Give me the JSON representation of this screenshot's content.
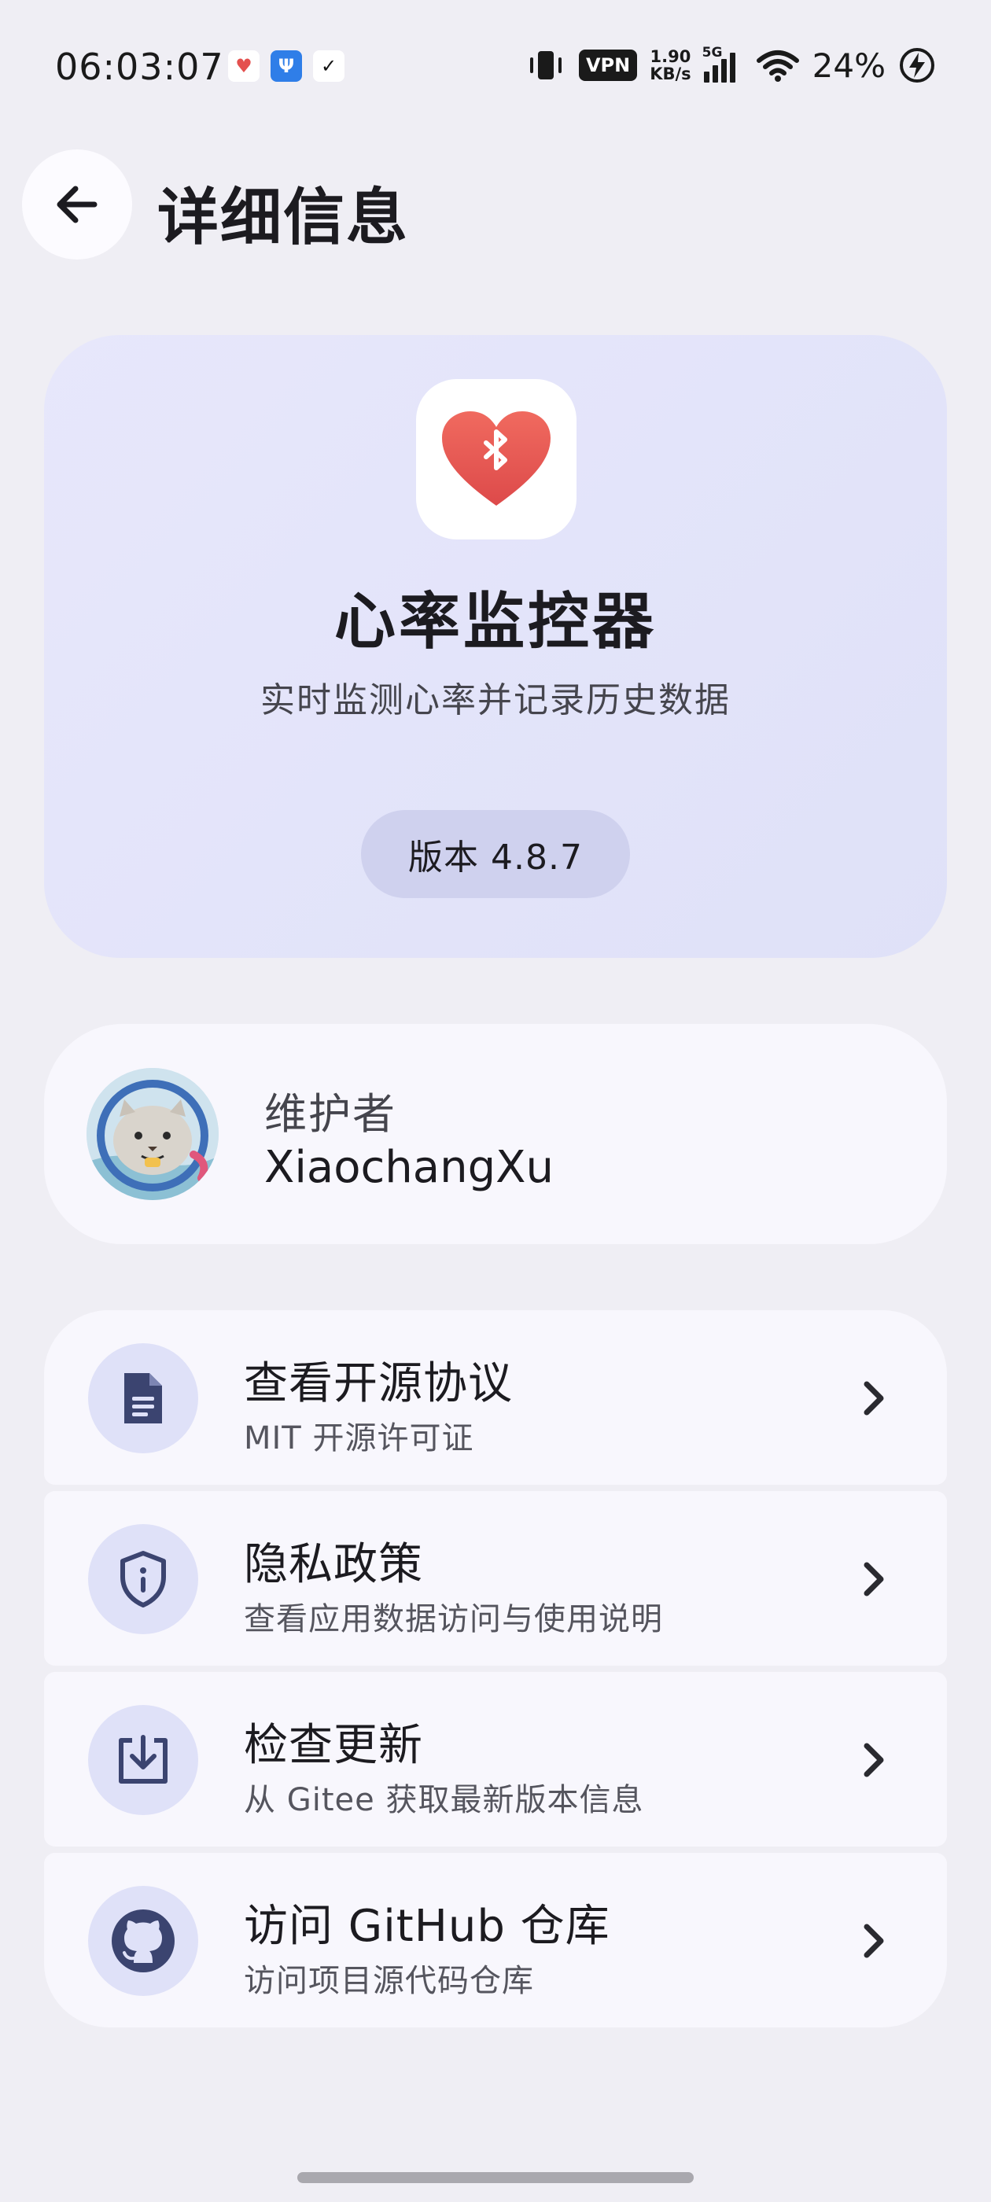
{
  "status_bar": {
    "time": "06:03:07",
    "vpn": "VPN",
    "net_speed_value": "1.90",
    "net_speed_unit": "KB/s",
    "network_type": "5G",
    "battery": "24%"
  },
  "header": {
    "title": "详细信息"
  },
  "app": {
    "name": "心率监控器",
    "description": "实时监测心率并记录历史数据",
    "version_label": "版本 4.8.7",
    "icon_color": "#e4504e"
  },
  "maintainer": {
    "label": "维护者",
    "name": "XiaochangXu"
  },
  "actions": [
    {
      "title": "查看开源协议",
      "subtitle": "MIT 开源许可证",
      "icon": "document-icon"
    },
    {
      "title": "隐私政策",
      "subtitle": "查看应用数据访问与使用说明",
      "icon": "shield-info-icon"
    },
    {
      "title": "检查更新",
      "subtitle": "从 Gitee 获取最新版本信息",
      "icon": "download-box-icon"
    },
    {
      "title": "访问 GitHub 仓库",
      "subtitle": "访问项目源代码仓库",
      "icon": "github-icon"
    }
  ],
  "colors": {
    "background": "#efeef4",
    "card": "#f8f7fd",
    "accent_bg": "#dfe1f8",
    "icon_fg": "#3b4470"
  }
}
